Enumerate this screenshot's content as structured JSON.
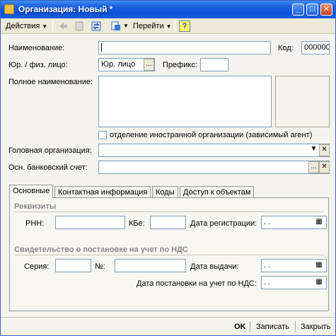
{
  "window": {
    "title": "Организация: Новый *"
  },
  "toolbar": {
    "actions_label": "Действия",
    "goto_label": "Перейти",
    "help_label": "?"
  },
  "form": {
    "name_label": "Наименование:",
    "name_value": "",
    "code_label": "Код:",
    "code_value": "000000",
    "entity_type_label": "Юр. / физ. лицо:",
    "entity_type_value": "Юр. лицо",
    "prefix_label": "Префикс:",
    "prefix_value": "",
    "full_name_label": "Полное наименование:",
    "full_name_value": "",
    "foreign_branch_label": "отделение иностранной организации (зависимый агент)",
    "head_org_label": "Головная организация:",
    "head_org_value": "",
    "bank_account_label": "Осн. банковский счет:",
    "bank_account_value": ""
  },
  "tabs": [
    {
      "label": "Основные"
    },
    {
      "label": "Контактная информация"
    },
    {
      "label": "Коды"
    },
    {
      "label": "Доступ к объектам"
    }
  ],
  "details": {
    "section_title": "Реквизиты",
    "rnn_label": "РНН:",
    "rnn_value": "",
    "kbe_label": "КБе:",
    "kbe_value": "",
    "reg_date_label": "Дата регистрации:",
    "reg_date_value": " .  .",
    "vat_section_title": "Свидетельство о постановке на учет по НДС",
    "series_label": "Серия:",
    "series_value": "",
    "number_label": "№:",
    "number_value": "",
    "issue_date_label": "Дата выдачи:",
    "issue_date_value": " .  .",
    "vat_reg_date_label": "Дата постановки на учет по НДС:",
    "vat_reg_date_value": " .  ."
  },
  "buttons": {
    "ok": "OK",
    "save": "Записать",
    "close": "Закрыть"
  }
}
